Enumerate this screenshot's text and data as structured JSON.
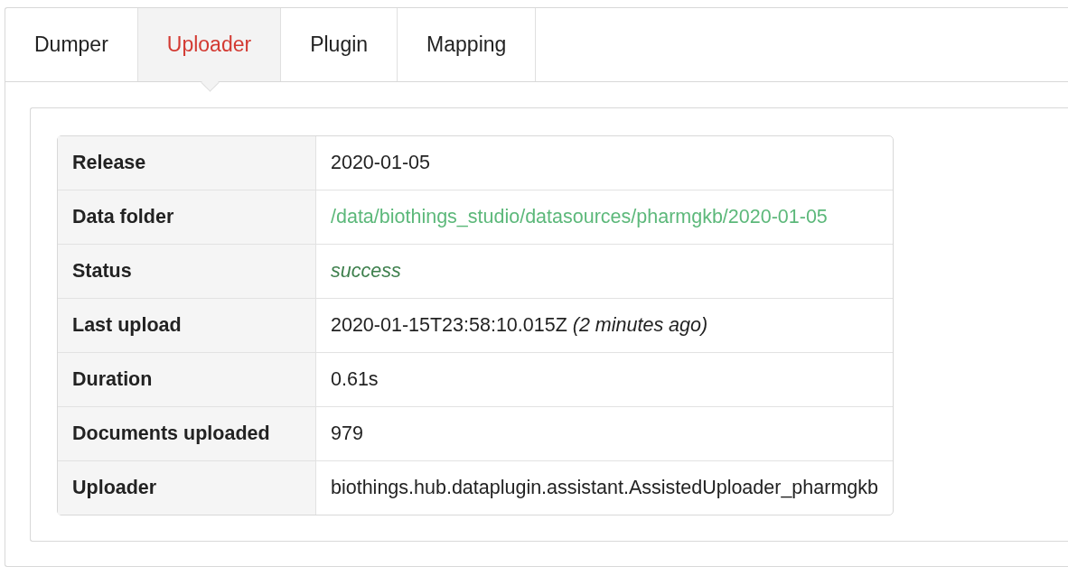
{
  "tabs": [
    {
      "label": "Dumper",
      "selected": false
    },
    {
      "label": "Uploader",
      "selected": true
    },
    {
      "label": "Plugin",
      "selected": false
    },
    {
      "label": "Mapping",
      "selected": false
    }
  ],
  "details": [
    {
      "label": "Release",
      "value": "2020-01-05",
      "kind": "text"
    },
    {
      "label": "Data folder",
      "value": "/data/biothings_studio/datasources/pharmgkb/2020-01-05",
      "kind": "link"
    },
    {
      "label": "Status",
      "value": "success",
      "kind": "status"
    },
    {
      "label": "Last upload",
      "value": "2020-01-15T23:58:10.015Z *(2 minutes ago)*",
      "kind": "text"
    },
    {
      "label": "Duration",
      "value": "0.61s",
      "kind": "text"
    },
    {
      "label": "Documents uploaded",
      "value": "979",
      "kind": "text"
    },
    {
      "label": "Uploader",
      "value": "biothings.hub.dataplugin.assistant.AssistedUploader_pharmgkb",
      "kind": "text"
    }
  ]
}
